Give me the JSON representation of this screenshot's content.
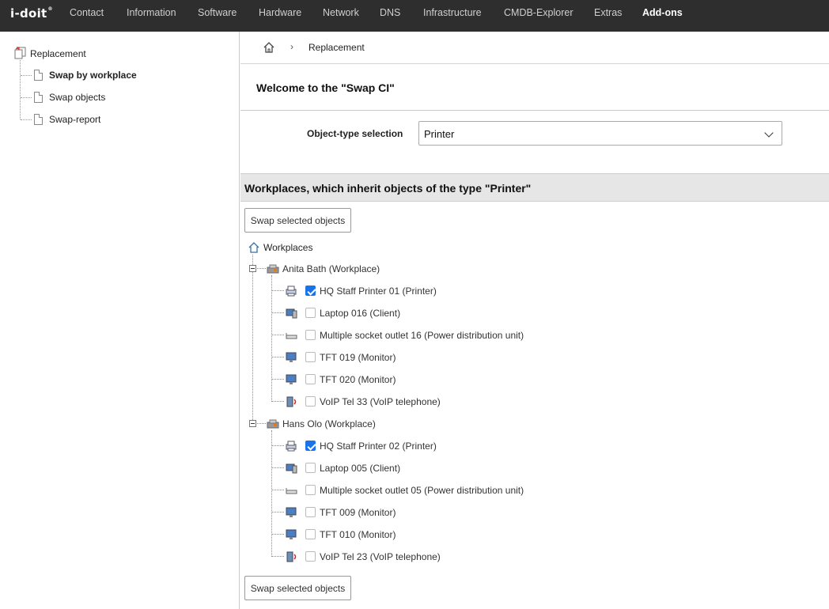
{
  "app": {
    "logo_text": "i-doit",
    "logo_mark": "®"
  },
  "nav": {
    "items": [
      {
        "label": "Contact"
      },
      {
        "label": "Information"
      },
      {
        "label": "Software"
      },
      {
        "label": "Hardware"
      },
      {
        "label": "Network"
      },
      {
        "label": "DNS"
      },
      {
        "label": "Infrastructure"
      },
      {
        "label": "CMDB-Explorer"
      },
      {
        "label": "Extras"
      },
      {
        "label": "Add-ons",
        "active": true
      }
    ]
  },
  "sidebar": {
    "root_label": "Replacement",
    "items": [
      {
        "label": "Swap by workplace",
        "selected": true
      },
      {
        "label": "Swap objects"
      },
      {
        "label": "Swap-report"
      }
    ]
  },
  "breadcrumb": {
    "separator": "›",
    "current": "Replacement"
  },
  "main": {
    "welcome": "Welcome to the \"Swap CI\"",
    "object_type_label": "Object-type selection",
    "object_type_value": "Printer",
    "section_title": "Workplaces, which inherit objects of the type \"Printer\"",
    "swap_button_top": "Swap selected objects",
    "swap_button_bottom": "Swap selected objects",
    "tree_root": "Workplaces",
    "workplaces": [
      {
        "label": "Anita Bath (Workplace)",
        "objects": [
          {
            "label": "HQ Staff Printer 01 (Printer)",
            "checked": true,
            "icon": "printer-icon"
          },
          {
            "label": "Laptop 016 (Client)",
            "checked": false,
            "icon": "client-icon"
          },
          {
            "label": "Multiple socket outlet 16 (Power distribution unit)",
            "checked": false,
            "icon": "power-strip-icon"
          },
          {
            "label": "TFT 019 (Monitor)",
            "checked": false,
            "icon": "monitor-icon"
          },
          {
            "label": "TFT 020 (Monitor)",
            "checked": false,
            "icon": "monitor-icon"
          },
          {
            "label": "VoIP Tel 33 (VoIP telephone)",
            "checked": false,
            "icon": "voip-phone-icon"
          }
        ]
      },
      {
        "label": "Hans Olo (Workplace)",
        "objects": [
          {
            "label": "HQ Staff Printer 02 (Printer)",
            "checked": true,
            "icon": "printer-icon"
          },
          {
            "label": "Laptop 005 (Client)",
            "checked": false,
            "icon": "client-icon"
          },
          {
            "label": "Multiple socket outlet 05 (Power distribution unit)",
            "checked": false,
            "icon": "power-strip-icon"
          },
          {
            "label": "TFT 009 (Monitor)",
            "checked": false,
            "icon": "monitor-icon"
          },
          {
            "label": "TFT 010 (Monitor)",
            "checked": false,
            "icon": "monitor-icon"
          },
          {
            "label": "VoIP Tel 23 (VoIP telephone)",
            "checked": false,
            "icon": "voip-phone-icon"
          }
        ]
      }
    ]
  }
}
